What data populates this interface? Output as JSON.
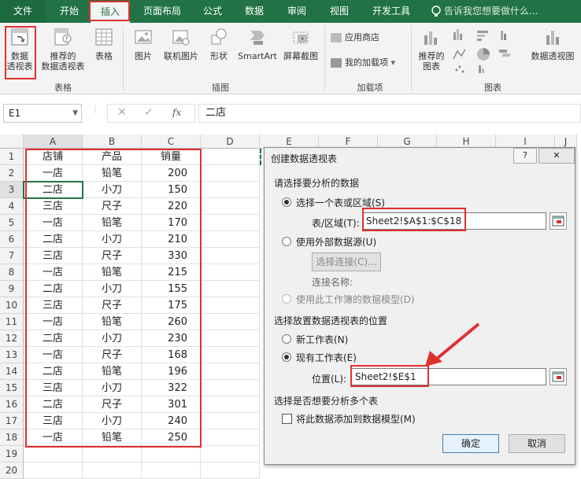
{
  "tabs": [
    "文件",
    "开始",
    "插入",
    "页面布局",
    "公式",
    "数据",
    "审阅",
    "视图",
    "开发工具"
  ],
  "tell_me": "告诉我您想要做什么...",
  "ribbon": {
    "pivot_table": [
      "数据",
      "透视表"
    ],
    "recommended_pivot": [
      "推荐的",
      "数据透视表"
    ],
    "table": "表格",
    "group_table": "表格",
    "picture": "图片",
    "online_picture": "联机图片",
    "shapes": "形状",
    "smartart": "SmartArt",
    "screenshot": "屏幕截图",
    "group_illustrations": "插图",
    "app_store": "应用商店",
    "my_addins": "我的加载项",
    "group_addins": "加载项",
    "recommended_charts": [
      "推荐的",
      "图表"
    ],
    "pivot_chart": "数据透视图",
    "group_charts": "图表"
  },
  "formula_bar": {
    "name_box": "E1",
    "fx": "fx",
    "content": "二店"
  },
  "columns": [
    "A",
    "B",
    "C",
    "D",
    "E",
    "F",
    "G",
    "H",
    "I",
    "J"
  ],
  "rows": [
    "1",
    "2",
    "3",
    "4",
    "5",
    "6",
    "7",
    "8",
    "9",
    "10",
    "11",
    "12",
    "13",
    "14",
    "15",
    "16",
    "17",
    "18",
    "19",
    "20"
  ],
  "table": [
    [
      "店铺",
      "产品",
      "销量"
    ],
    [
      "一店",
      "铅笔",
      "200"
    ],
    [
      "二店",
      "小刀",
      "150"
    ],
    [
      "三店",
      "尺子",
      "220"
    ],
    [
      "一店",
      "铅笔",
      "170"
    ],
    [
      "二店",
      "小刀",
      "210"
    ],
    [
      "三店",
      "尺子",
      "330"
    ],
    [
      "一店",
      "铅笔",
      "215"
    ],
    [
      "二店",
      "小刀",
      "155"
    ],
    [
      "三店",
      "尺子",
      "175"
    ],
    [
      "一店",
      "铅笔",
      "260"
    ],
    [
      "二店",
      "小刀",
      "230"
    ],
    [
      "一店",
      "尺子",
      "168"
    ],
    [
      "二店",
      "铅笔",
      "196"
    ],
    [
      "三店",
      "小刀",
      "322"
    ],
    [
      "二店",
      "尺子",
      "301"
    ],
    [
      "三店",
      "小刀",
      "240"
    ],
    [
      "一店",
      "铅笔",
      "250"
    ]
  ],
  "dialog": {
    "title": "创建数据透视表",
    "help": "?",
    "close": "✕",
    "section1": "请选择要分析的数据",
    "opt_range": "选择一个表或区域(S)",
    "range_label": "表/区域(T):",
    "range_value": "Sheet2!$A$1:$C$18",
    "opt_external": "使用外部数据源(U)",
    "choose_conn": "选择连接(C)...",
    "conn_name": "连接名称:",
    "opt_model": "使用此工作簿的数据模型(D)",
    "section2": "选择放置数据透视表的位置",
    "opt_new": "新工作表(N)",
    "opt_existing": "现有工作表(E)",
    "loc_label": "位置(L):",
    "loc_value": "Sheet2!$E$1",
    "section3": "选择是否想要分析多个表",
    "add_model": "将此数据添加到数据模型(M)",
    "ok": "确定",
    "cancel": "取消"
  },
  "colors": {
    "excel_green": "#217346",
    "highlight_red": "#e0302e"
  }
}
